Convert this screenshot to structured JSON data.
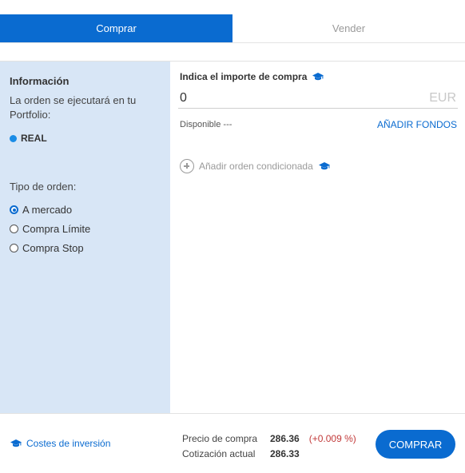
{
  "tabs": {
    "buy": "Comprar",
    "sell": "Vender"
  },
  "sidebar": {
    "title": "Información",
    "description": "La orden se ejecutará en tu Portfolio:",
    "portfolio": "REAL",
    "order_type_label": "Tipo de orden:",
    "order_types": [
      {
        "label": "A mercado",
        "selected": true
      },
      {
        "label": "Compra Límite",
        "selected": false
      },
      {
        "label": "Compra Stop",
        "selected": false
      }
    ]
  },
  "main": {
    "amount_label": "Indica el importe de compra",
    "amount_value": "0",
    "currency": "EUR",
    "available": "Disponible ---",
    "add_funds": "AÑADIR FONDOS",
    "conditional_order": "Añadir orden condicionada"
  },
  "footer": {
    "costs_link": "Costes de inversión",
    "purchase_price_label": "Precio de compra",
    "purchase_price_value": "286.36",
    "purchase_price_change": "(+0.009 %)",
    "current_quote_label": "Cotización actual",
    "current_quote_value": "286.33",
    "buy_button": "COMPRAR"
  },
  "icons": {
    "info": "graduation-cap-icon",
    "add": "plus-circle-icon",
    "portfolio_dot": "status-dot-icon"
  },
  "colors": {
    "accent": "#0a6bd0",
    "sidebar_bg": "#d8e6f6",
    "negative": "#c23a3a",
    "dot": "#1a8ce6"
  }
}
